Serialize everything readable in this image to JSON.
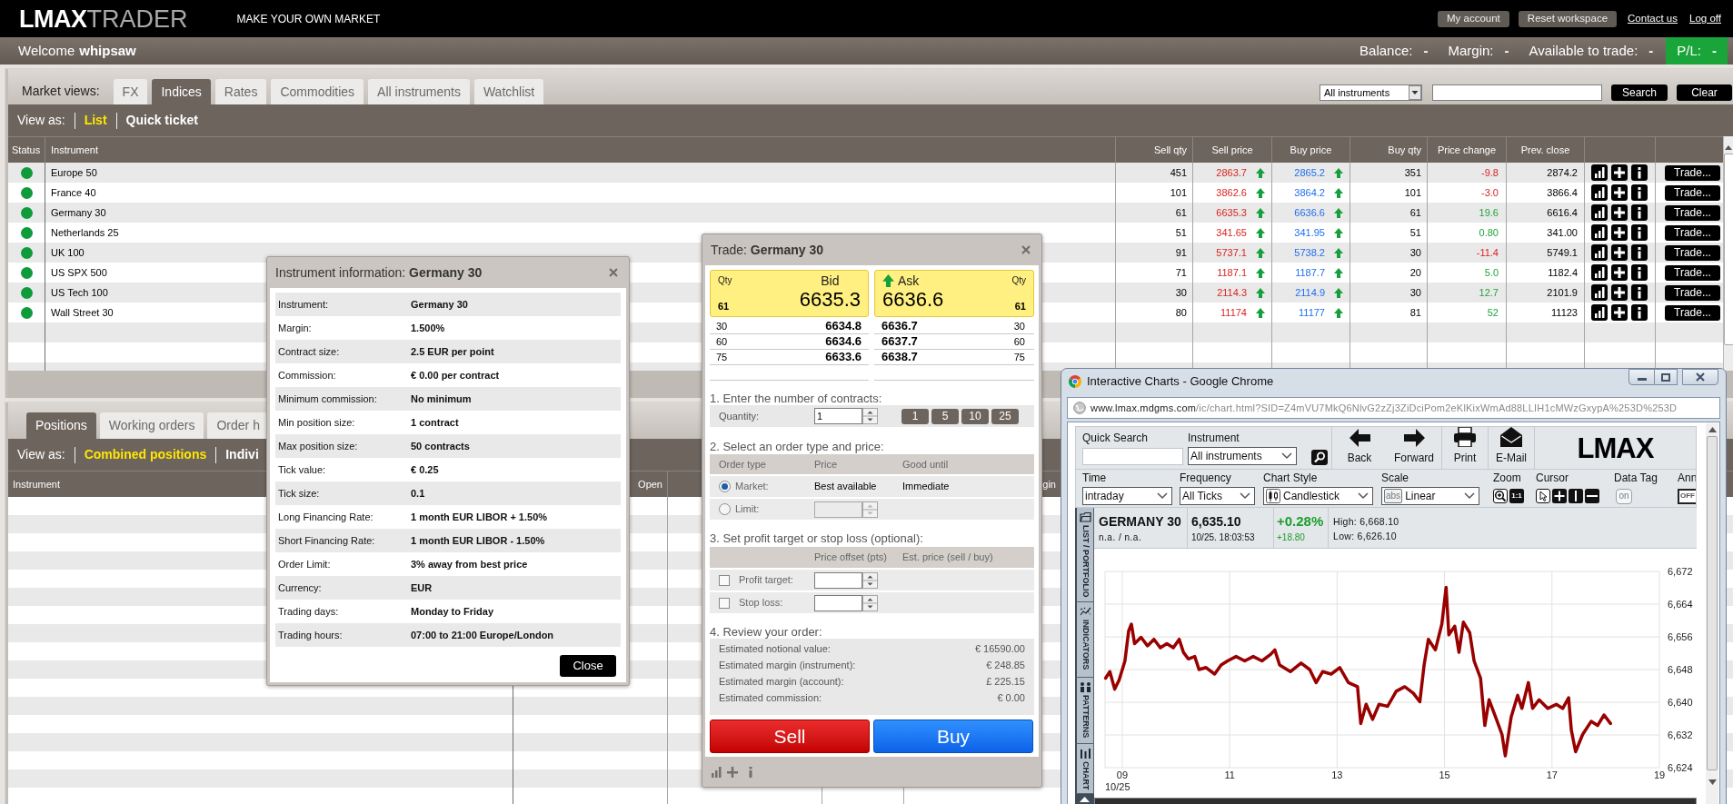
{
  "top_bar": {
    "logo": {
      "brand": "LMAX",
      "product": "TRADER"
    },
    "tagline": "MAKE YOUR OWN MARKET",
    "buttons": [
      "My account",
      "Reset workspace"
    ],
    "links": [
      "Contact us",
      "Log off"
    ]
  },
  "account_bar": {
    "greeting": "Welcome",
    "username": "whipsaw",
    "fields": [
      {
        "label": "Balance:",
        "value": "-",
        "kind": "plain"
      },
      {
        "label": "Margin:",
        "value": "-",
        "kind": "plain"
      },
      {
        "label": "Available to trade:",
        "value": "-",
        "kind": "plain"
      },
      {
        "label": "P/L:",
        "value": "-",
        "kind": "highlight"
      }
    ]
  },
  "market_views": {
    "label": "Market views:",
    "tabs": [
      {
        "label": "FX",
        "selected": false
      },
      {
        "label": "Indices",
        "selected": true
      },
      {
        "label": "Rates",
        "selected": false
      },
      {
        "label": "Commodities",
        "selected": false
      },
      {
        "label": "All instruments",
        "selected": false
      },
      {
        "label": "Watchlist",
        "selected": false
      }
    ],
    "filter": {
      "value": "All instruments"
    },
    "search_button": "Search",
    "clear_button": "Clear",
    "view_as": {
      "label": "View as:",
      "options": [
        {
          "label": "List",
          "selected": true
        },
        {
          "label": "Quick ticket",
          "selected": false
        }
      ]
    },
    "table": {
      "columns": [
        "Status",
        "Instrument",
        "Sell qty",
        "Sell price",
        "Buy price",
        "Buy qty",
        "Price change",
        "Prev. close"
      ],
      "rows": [
        {
          "open": true,
          "instrument": "Europe 50",
          "sell_qty": "451",
          "sell_price": "2863.7",
          "sell_up": true,
          "buy_price": "2865.2",
          "buy_up": true,
          "buy_qty": "351",
          "change": "-9.8",
          "change_up": false,
          "prev_close": "2874.2",
          "trade_button": "Trade..."
        },
        {
          "open": true,
          "instrument": "France 40",
          "sell_qty": "101",
          "sell_price": "3862.6",
          "sell_up": true,
          "buy_price": "3864.2",
          "buy_up": true,
          "buy_qty": "101",
          "change": "-3.0",
          "change_up": false,
          "prev_close": "3866.4",
          "trade_button": "Trade..."
        },
        {
          "open": true,
          "instrument": "Germany 30",
          "sell_qty": "61",
          "sell_price": "6635.3",
          "sell_up": true,
          "buy_price": "6636.6",
          "buy_up": true,
          "buy_qty": "61",
          "change": "19.6",
          "change_up": true,
          "prev_close": "6616.4",
          "trade_button": "Trade..."
        },
        {
          "open": true,
          "instrument": "Netherlands 25",
          "sell_qty": "51",
          "sell_price": "341.65",
          "sell_up": true,
          "buy_price": "341.95",
          "buy_up": true,
          "buy_qty": "51",
          "change": "0.80",
          "change_up": true,
          "prev_close": "341.00",
          "trade_button": "Trade..."
        },
        {
          "open": true,
          "instrument": "UK 100",
          "sell_qty": "91",
          "sell_price": "5737.1",
          "sell_up": true,
          "buy_price": "5738.2",
          "buy_up": true,
          "buy_qty": "30",
          "change": "-11.4",
          "change_up": false,
          "prev_close": "5749.1",
          "trade_button": "Trade..."
        },
        {
          "open": true,
          "instrument": "US SPX 500",
          "sell_qty": "71",
          "sell_price": "1187.1",
          "sell_up": true,
          "buy_price": "1187.7",
          "buy_up": true,
          "buy_qty": "20",
          "change": "5.0",
          "change_up": true,
          "prev_close": "1182.4",
          "trade_button": "Trade..."
        },
        {
          "open": true,
          "instrument": "US Tech 100",
          "sell_qty": "30",
          "sell_price": "2114.3",
          "sell_up": true,
          "buy_price": "2114.9",
          "buy_up": true,
          "buy_qty": "30",
          "change": "12.7",
          "change_up": true,
          "prev_close": "2101.9",
          "trade_button": "Trade..."
        },
        {
          "open": true,
          "instrument": "Wall Street 30",
          "sell_qty": "80",
          "sell_price": "11174",
          "sell_up": true,
          "buy_price": "11177",
          "buy_up": true,
          "buy_qty": "81",
          "change": "52",
          "change_up": true,
          "prev_close": "11123",
          "trade_button": "Trade..."
        }
      ]
    }
  },
  "positions": {
    "tabs": [
      {
        "label": "Positions",
        "selected": true
      },
      {
        "label": "Working orders",
        "selected": false
      },
      {
        "label": "Order h",
        "selected": false
      }
    ],
    "view_as": {
      "label": "View as:",
      "options": [
        {
          "label": "Combined positions",
          "selected": true
        },
        {
          "label": "Indivi",
          "selected": false
        }
      ]
    },
    "columns": [
      "Instrument",
      "Open",
      "gin"
    ]
  },
  "instrument_info": {
    "title": "Instrument information: **Germany 30**",
    "rows": [
      {
        "label": "Instrument:",
        "value": "Germany 30"
      },
      {
        "label": "Margin:",
        "value": "1.500%"
      },
      {
        "label": "Contract size:",
        "value": "2.5 EUR per point"
      },
      {
        "label": "Commission:",
        "value": "€ 0.00 per contract"
      },
      {
        "label": "Minimum commission:",
        "value": "No minimum"
      },
      {
        "label": "Min position size:",
        "value": "1 contract"
      },
      {
        "label": "Max position size:",
        "value": "50 contracts"
      },
      {
        "label": "Tick value:",
        "value": "€ 0.25"
      },
      {
        "label": "Tick size:",
        "value": "0.1"
      },
      {
        "label": "Long Financing Rate:",
        "value": "1 month EUR LIBOR + 1.50%"
      },
      {
        "label": "Short Financing Rate:",
        "value": "1 month EUR LIBOR - 1.50%"
      },
      {
        "label": "Order Limit:",
        "value": "3% away from best price"
      },
      {
        "label": "Currency:",
        "value": "EUR"
      },
      {
        "label": "Trading days:",
        "value": "Monday to Friday"
      },
      {
        "label": "Trading hours:",
        "value": "07:00 to 21:00 Europe/London"
      }
    ],
    "close_button": "Close"
  },
  "trade_ticket": {
    "title": "Trade: **Germany 30**",
    "bid": {
      "qty_label": "Qty",
      "label": "Bid",
      "qty": "61",
      "price": "6635.3"
    },
    "ask": {
      "qty_label": "Qty",
      "label": "Ask",
      "qty": "61",
      "price": "6636.6",
      "up": true
    },
    "bid_depth": [
      {
        "qty": "30",
        "price": "6634.8"
      },
      {
        "qty": "60",
        "price": "6634.6"
      },
      {
        "qty": "75",
        "price": "6633.6"
      }
    ],
    "ask_depth": [
      {
        "qty": "30",
        "price": "6636.7"
      },
      {
        "qty": "60",
        "price": "6637.7"
      },
      {
        "qty": "75",
        "price": "6638.7"
      }
    ],
    "contracts": {
      "title": "1. Enter the number of contracts:",
      "label": "Quantity:",
      "value": "1",
      "presets": [
        "1",
        "5",
        "10",
        "25"
      ]
    },
    "order_type": {
      "title": "2. Select an order type and price:",
      "columns": [
        "Order type",
        "Price",
        "Good until"
      ],
      "options": [
        {
          "kind": "market",
          "label": "Market:",
          "selected": true,
          "price": "Best available",
          "good_until": "Immediate"
        },
        {
          "kind": "limit",
          "label": "Limit:",
          "selected": false
        }
      ]
    },
    "exits": {
      "title": "3. Set profit target or stop loss (optional):",
      "columns": [
        "Price offset (pts)",
        "Est. price (sell / buy)"
      ],
      "options": [
        {
          "label": "Profit target:",
          "checked": false
        },
        {
          "label": "Stop loss:",
          "checked": false
        }
      ]
    },
    "review": {
      "title": "4. Review your order:",
      "lines": [
        {
          "label": "Estimated notional value:",
          "value": "€ 16590.00"
        },
        {
          "label": "Estimated margin (instrument):",
          "value": "€ 248.85"
        },
        {
          "label": "Estimated margin (account):",
          "value": "£ 225.15"
        },
        {
          "label": "Estimated commission:",
          "value": "€ 0.00"
        }
      ]
    },
    "sell_button": "Sell",
    "buy_button": "Buy"
  },
  "chart_window": {
    "title": "Interactive Charts - Google Chrome",
    "url_host": "www.lmax.mdgms.com",
    "url_path": "/ic/chart.html?SID=Z4mVU7MkQ6NlvG2zZj3ZiDciPom2eKlKixWmAd88LLIH1cMWzGxypA%253D%253D",
    "quick_search_label": "Quick Search",
    "instrument_label": "Instrument",
    "instrument_value": "All instruments",
    "nav": [
      {
        "kind": "back",
        "label": "Back"
      },
      {
        "kind": "forward",
        "label": "Forward"
      },
      {
        "kind": "print",
        "label": "Print"
      },
      {
        "kind": "email",
        "label": "E-Mail"
      }
    ],
    "logo": "LMAX",
    "settings": [
      {
        "kind": "select",
        "label": "Time",
        "value": "intraday"
      },
      {
        "kind": "select",
        "label": "Frequency",
        "value": "All Ticks"
      },
      {
        "kind": "icon_select",
        "label": "Chart Style",
        "value": "Candlestick"
      },
      {
        "kind": "select",
        "label": "Scale",
        "value": "Linear",
        "badge": "abs"
      },
      {
        "kind": "zoom",
        "label": "Zoom",
        "reset_label": "1:1"
      },
      {
        "kind": "cursor",
        "label": "Cursor"
      },
      {
        "kind": "tag_toggle",
        "label": "Data Tag",
        "value": "on"
      },
      {
        "kind": "box_toggle",
        "label": "Ann",
        "value": "OFF"
      }
    ],
    "side_tabs": [
      {
        "kind": "list",
        "label": "LIST / PORTFOLIO"
      },
      {
        "kind": "indicators",
        "label": "INDICATORS"
      },
      {
        "kind": "patterns",
        "label": "PATTERNS"
      },
      {
        "kind": "chart",
        "label": "CHART"
      }
    ],
    "quote": {
      "name": "GERMANY 30",
      "exchange": "n.a. / n.a.",
      "price": "6,635.10",
      "timestamp": "10/25. 18:03:53",
      "change_percent": "+0.28%",
      "change": "+18.80",
      "up": true,
      "high": "High: 6,668.10",
      "low": "Low: 6,626.10"
    },
    "chart": {
      "date_label": "10/25",
      "chart_data": {
        "type": "line",
        "grid": true,
        "x": [
          8.69,
          8.77,
          8.86,
          8.94,
          9.05,
          9.12,
          9.17,
          9.23,
          9.35,
          9.47,
          9.59,
          9.71,
          9.83,
          9.95,
          10.06,
          10.14,
          10.23,
          10.35,
          10.43,
          10.56,
          10.72,
          10.84,
          10.96,
          11.12,
          11.28,
          11.44,
          11.6,
          11.76,
          11.84,
          11.93,
          12.13,
          12.33,
          12.49,
          12.61,
          12.73,
          12.89,
          13.05,
          13.21,
          13.38,
          13.44,
          13.54,
          13.66,
          13.78,
          13.94,
          14.1,
          14.26,
          14.42,
          14.54,
          14.62,
          14.7,
          14.83,
          14.95,
          15.03,
          15.08,
          15.19,
          15.27,
          15.35,
          15.47,
          15.55,
          15.67,
          15.75,
          15.83,
          15.95,
          16.07,
          16.13,
          16.24,
          16.36,
          16.44,
          16.56,
          16.64,
          16.76,
          16.92,
          17.08,
          17.2,
          17.31,
          17.36,
          17.44,
          17.57,
          17.73,
          17.85,
          17.97,
          18.09
        ],
        "series": [
          {
            "color": "#990000",
            "values": [
              6645.9,
              6647.5,
              6643.2,
              6645.4,
              6650.1,
              6657.5,
              6659.1,
              6654.3,
              6655.9,
              6653.8,
              6655.4,
              6653.3,
              6654.3,
              6653.3,
              6655.4,
              6652.2,
              6650.6,
              6651.2,
              6648.0,
              6648.5,
              6646.9,
              6649.1,
              6650.1,
              6651.2,
              6650.1,
              6651.2,
              6650.1,
              6651.7,
              6652.8,
              6649.1,
              6647.5,
              6649.6,
              6648.0,
              6644.8,
              6647.5,
              6646.9,
              6648.5,
              6644.8,
              6643.8,
              6634.8,
              6639.5,
              6635.8,
              6639.5,
              6639.0,
              6642.7,
              6643.8,
              6642.2,
              6640.1,
              6649.1,
              6655.4,
              6652.8,
              6659.1,
              6668.1,
              6656.5,
              6658.6,
              6652.2,
              6659.6,
              6657.0,
              6650.1,
              6645.9,
              6634.3,
              6640.6,
              6636.4,
              6632.1,
              6626.9,
              6636.4,
              6641.7,
              6638.5,
              6644.8,
              6638.5,
              6640.6,
              6638.5,
              6639.5,
              6638.5,
              6641.1,
              6633.2,
              6627.9,
              6632.1,
              6635.3,
              6634.3,
              6636.9,
              6634.8
            ]
          }
        ],
        "xlim": [
          8.68,
          19
        ],
        "ylim": [
          6624,
          6672
        ],
        "xticks": [
          {
            "value": 9,
            "label": "09"
          },
          {
            "value": 11,
            "label": "11"
          },
          {
            "value": 13,
            "label": "13"
          },
          {
            "value": 15,
            "label": "15"
          },
          {
            "value": 17,
            "label": "17"
          },
          {
            "value": 19,
            "label": "19"
          }
        ],
        "yticks": [
          {
            "value": 6624,
            "label": "6,624"
          },
          {
            "value": 6632,
            "label": "6,632"
          },
          {
            "value": 6640,
            "label": "6,640"
          },
          {
            "value": 6648,
            "label": "6,648"
          },
          {
            "value": 6656,
            "label": "6,656"
          },
          {
            "value": 6664,
            "label": "6,664"
          },
          {
            "value": 6672,
            "label": "6,672"
          }
        ]
      }
    }
  }
}
